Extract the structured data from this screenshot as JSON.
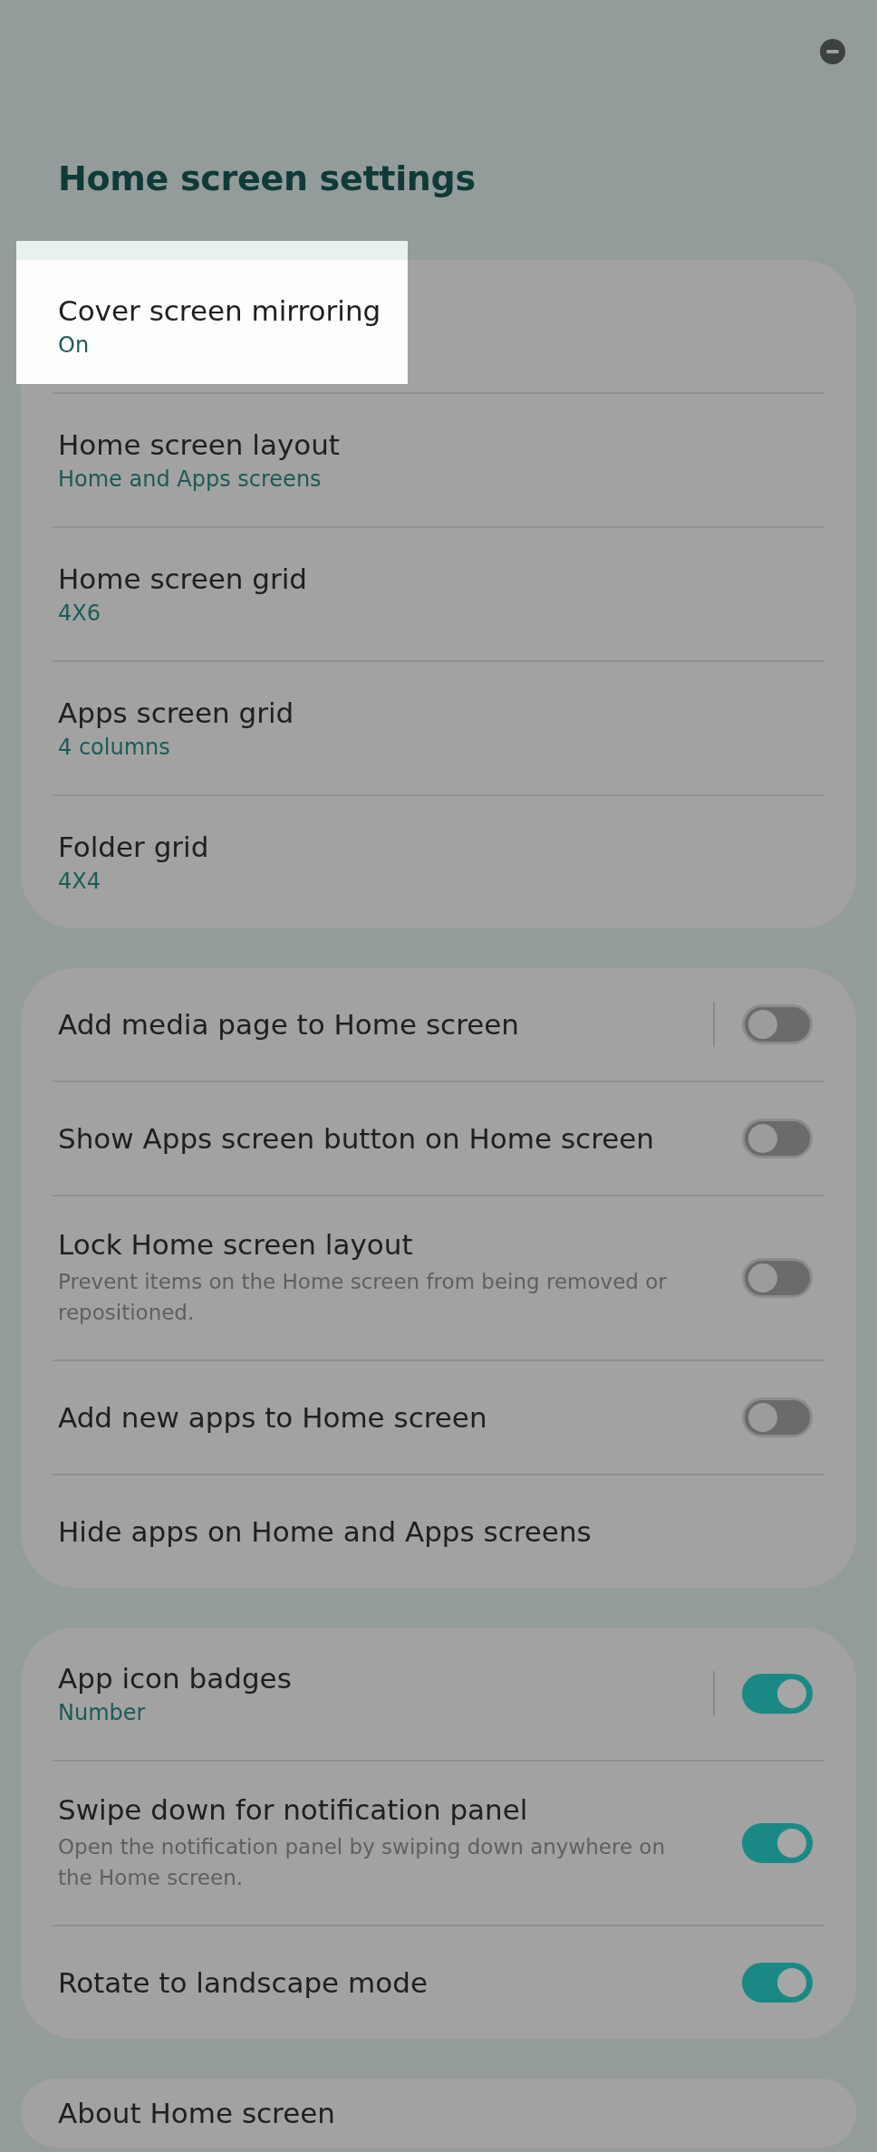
{
  "title": "Home screen settings",
  "sections": [
    {
      "items": [
        {
          "kind": "link",
          "title": "Cover screen mirroring",
          "value": "On",
          "highlighted": true
        },
        {
          "kind": "link",
          "title": "Home screen layout",
          "value": "Home and Apps screens",
          "highlighted": false
        },
        {
          "kind": "link",
          "title": "Home screen grid",
          "value": "4X6",
          "highlighted": false
        },
        {
          "kind": "link",
          "title": "Apps screen grid",
          "value": "4 columns",
          "highlighted": false
        },
        {
          "kind": "link",
          "title": "Folder grid",
          "value": "4X4",
          "highlighted": false
        }
      ]
    },
    {
      "items": [
        {
          "kind": "toggle",
          "title": "Add media page to Home screen",
          "on": false,
          "split": true,
          "highlighted": false
        },
        {
          "kind": "toggle",
          "title": "Show Apps screen button on Home screen",
          "on": false,
          "split": false,
          "highlighted": false
        },
        {
          "kind": "toggle",
          "title": "Lock Home screen layout",
          "description": "Prevent items on the Home screen from being removed or repositioned.",
          "on": false,
          "split": false,
          "highlighted": false
        },
        {
          "kind": "toggle",
          "title": "Add new apps to Home screen",
          "on": false,
          "split": false,
          "highlighted": false
        },
        {
          "kind": "link",
          "title": "Hide apps on Home and Apps screens",
          "highlighted": false
        }
      ]
    },
    {
      "items": [
        {
          "kind": "toggle",
          "title": "App icon badges",
          "value": "Number",
          "on": true,
          "split": true,
          "highlighted": false
        },
        {
          "kind": "toggle",
          "title": "Swipe down for notification panel",
          "description": "Open the notification panel by swiping down anywhere on the Home screen.",
          "on": true,
          "split": false,
          "highlighted": false
        },
        {
          "kind": "toggle",
          "title": "Rotate to landscape mode",
          "on": true,
          "split": false,
          "highlighted": false
        }
      ]
    },
    {
      "items": [
        {
          "kind": "link",
          "title": "About Home screen",
          "highlighted": false
        }
      ]
    }
  ]
}
